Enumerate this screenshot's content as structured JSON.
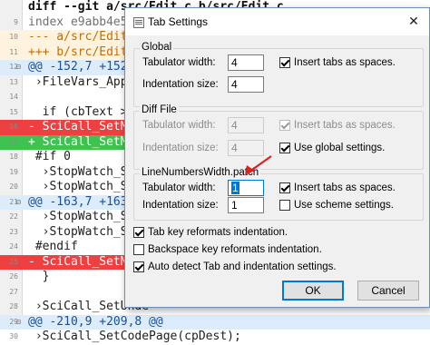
{
  "editor": {
    "lines": [
      {
        "num": "",
        "fold": "",
        "type": "header",
        "text": "diff --git a/src/Edit.c b/src/Edit.c"
      },
      {
        "num": "9",
        "fold": "",
        "type": "index",
        "text": "index e9abb4e5..."
      },
      {
        "num": "10",
        "fold": "",
        "type": "old-file",
        "text": "--- a/src/Edit.c"
      },
      {
        "num": "11",
        "fold": "",
        "type": "new-file",
        "text": "+++ b/src/Edit.c"
      },
      {
        "num": "12",
        "fold": "⊟",
        "type": "hunk",
        "text": "@@ -152,7 +152,7"
      },
      {
        "num": "13",
        "fold": "",
        "type": "ctx",
        "text": " ›FileVars_Apply"
      },
      {
        "num": "14",
        "fold": "",
        "type": "ctx",
        "text": ""
      },
      {
        "num": "15",
        "fold": "",
        "type": "ctx",
        "text": "  if (cbText > 0"
      },
      {
        "num": "16",
        "fold": "",
        "type": "del",
        "text": "- SciCall_SetMo"
      },
      {
        "num": "17",
        "fold": "",
        "type": "add",
        "text": "+ SciCall_SetMo"
      },
      {
        "num": "18",
        "fold": "",
        "type": "ctx",
        "text": " #if 0"
      },
      {
        "num": "19",
        "fold": "",
        "type": "ctx",
        "text": "  ›StopWatch_Sto"
      },
      {
        "num": "20",
        "fold": "",
        "type": "ctx",
        "text": "  ›StopWatch_Sta"
      },
      {
        "num": "21",
        "fold": "⊟",
        "type": "hunk",
        "text": "@@ -163,7 +163,6"
      },
      {
        "num": "22",
        "fold": "",
        "type": "ctx",
        "text": "  ›StopWatch_Stop"
      },
      {
        "num": "23",
        "fold": "",
        "type": "ctx",
        "text": "  ›StopWatch_Show"
      },
      {
        "num": "24",
        "fold": "",
        "type": "ctx",
        "text": " #endif"
      },
      {
        "num": "25",
        "fold": "",
        "type": "del",
        "text": "- SciCall_SetMo"
      },
      {
        "num": "26",
        "fold": "",
        "type": "ctx",
        "text": "  }"
      },
      {
        "num": "27",
        "fold": "",
        "type": "ctx",
        "text": ""
      },
      {
        "num": "28",
        "fold": "",
        "type": "ctx",
        "text": " ›SciCall_SetUnde"
      },
      {
        "num": "29",
        "fold": "⊟",
        "type": "hunk",
        "text": "@@ -210,9 +209,8 @@"
      },
      {
        "num": "30",
        "fold": "",
        "type": "ctx",
        "text": " ›SciCall_SetCodePage(cpDest);"
      }
    ]
  },
  "dialog": {
    "title": "Tab Settings",
    "close_glyph": "✕",
    "global": {
      "label": "Global",
      "tab_width_label": "Tabulator width:",
      "tab_width_value": "4",
      "indent_size_label": "Indentation size:",
      "indent_size_value": "4",
      "insert_tabs_label": "Insert tabs as spaces.",
      "insert_tabs_checked": true
    },
    "diff_file": {
      "label": "Diff File",
      "tab_width_label": "Tabulator width:",
      "tab_width_value": "4",
      "indent_size_label": "Indentation size:",
      "indent_size_value": "4",
      "insert_tabs_label": "Insert tabs as spaces.",
      "insert_tabs_checked": true,
      "use_global_label": "Use global settings.",
      "use_global_checked": true
    },
    "lexer": {
      "label": "LineNumbersWidth.patch",
      "tab_width_label": "Tabulator width:",
      "tab_width_value": "1",
      "indent_size_label": "Indentation size:",
      "indent_size_value": "1",
      "insert_tabs_label": "Insert tabs as spaces.",
      "insert_tabs_checked": true,
      "use_scheme_label": "Use scheme settings.",
      "use_scheme_checked": false
    },
    "options": {
      "tab_key_label": "Tab key reformats indentation.",
      "tab_key_checked": true,
      "backspace_label": "Backspace key reformats indentation.",
      "backspace_checked": false,
      "auto_detect_label": "Auto detect Tab and indentation settings.",
      "auto_detect_checked": true
    },
    "ok_label": "OK",
    "cancel_label": "Cancel"
  },
  "colors": {
    "annotation_arrow": "#e02020",
    "accent": "#0078d7",
    "diff_deleted": "#ee4040",
    "diff_added": "#3fc24f",
    "hunk_header": "#dcecfb"
  }
}
